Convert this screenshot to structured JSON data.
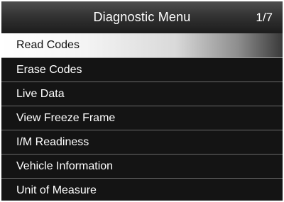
{
  "header": {
    "title": "Diagnostic Menu",
    "page_indicator": "1/7"
  },
  "menu": {
    "selected_index": 0,
    "items": [
      {
        "label": "Read Codes"
      },
      {
        "label": "Erase Codes"
      },
      {
        "label": "Live Data"
      },
      {
        "label": "View Freeze Frame"
      },
      {
        "label": "I/M Readiness"
      },
      {
        "label": "Vehicle Information"
      },
      {
        "label": "Unit of Measure"
      }
    ]
  },
  "colors": {
    "background": "#161616",
    "text": "#ffffff",
    "selected_text": "#111111",
    "divider": "#6a6a6a"
  }
}
